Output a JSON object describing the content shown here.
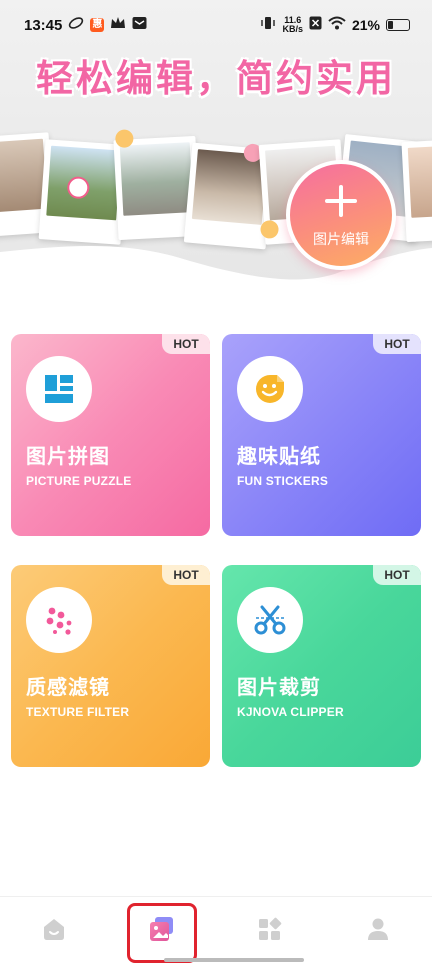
{
  "status_bar": {
    "time": "13:45",
    "net_speed_value": "11.6",
    "net_speed_unit": "KB/s",
    "battery": "21%",
    "app_badge_text": "惠"
  },
  "hero": {
    "title": "轻松编辑，简约实用",
    "edit_button_label": "图片编辑"
  },
  "cards": [
    {
      "title": "图片拼图",
      "subtitle": "PICTURE PUZZLE",
      "badge": "HOT",
      "icon": "puzzle-grid-icon"
    },
    {
      "title": "趣味贴纸",
      "subtitle": "FUN STICKERS",
      "badge": "HOT",
      "icon": "smiley-sticker-icon"
    },
    {
      "title": "质感滤镜",
      "subtitle": "TEXTURE FILTER",
      "badge": "HOT",
      "icon": "filter-dots-icon"
    },
    {
      "title": "图片裁剪",
      "subtitle": "KJNOVA CLIPPER",
      "badge": "HOT",
      "icon": "scissors-icon"
    }
  ],
  "bottom_nav": [
    {
      "icon": "home-icon",
      "active": false
    },
    {
      "icon": "gallery-icon",
      "active": true
    },
    {
      "icon": "apps-grid-icon",
      "active": false
    },
    {
      "icon": "profile-icon",
      "active": false
    }
  ],
  "colors": {
    "title_pink": "#f266a4",
    "puzzle_card": "#f98ab5",
    "stickers_card": "#8b86f8",
    "filter_card": "#fbb850",
    "clipper_card": "#49d79b",
    "nav_highlight": "#e0232e"
  }
}
